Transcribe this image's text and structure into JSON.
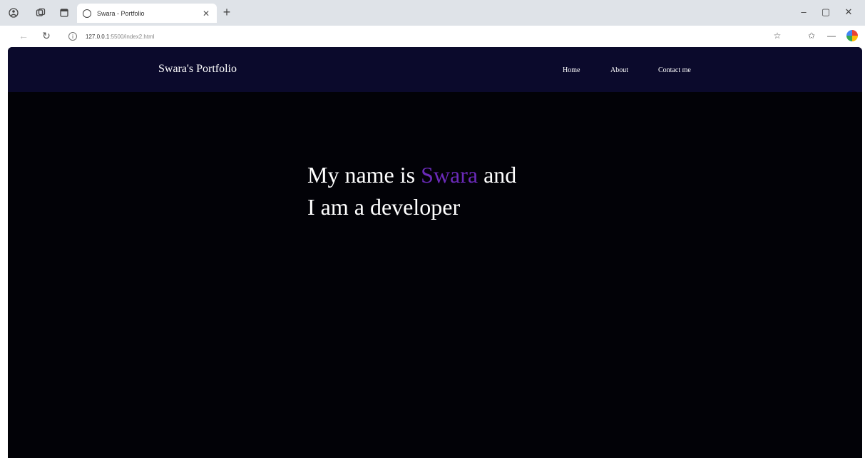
{
  "browser": {
    "tab_title": "Swara - Portfolio",
    "url_host": "127.0.0.1",
    "url_path": ":5500/index2.html"
  },
  "icons": {
    "tab_actions": "tab-actions-icon",
    "workspaces": "workspaces-icon",
    "vertical_tabs": "vertical-tabs-icon",
    "favicon": "globe-icon",
    "close": "close-icon",
    "new_tab": "plus-icon",
    "back": "back-arrow-icon",
    "reload": "reload-icon",
    "info": "info-icon",
    "favorite": "star-icon",
    "favorites_list": "favorites-icon",
    "more": "more-icon",
    "profile": "copilot-icon"
  },
  "navbar": {
    "brand": "Swara's Portfolio",
    "links": [
      "Home",
      "About",
      "Contact me"
    ]
  },
  "hero": {
    "line1_prefix": "My name is ",
    "name": "Swara",
    "line1_suffix": " and",
    "line2": "I am a developer"
  },
  "colors": {
    "navbar_bg": "#0b0a2c",
    "page_bg": "#020207",
    "accent": "#6a2ab8",
    "text": "#ffffff"
  }
}
